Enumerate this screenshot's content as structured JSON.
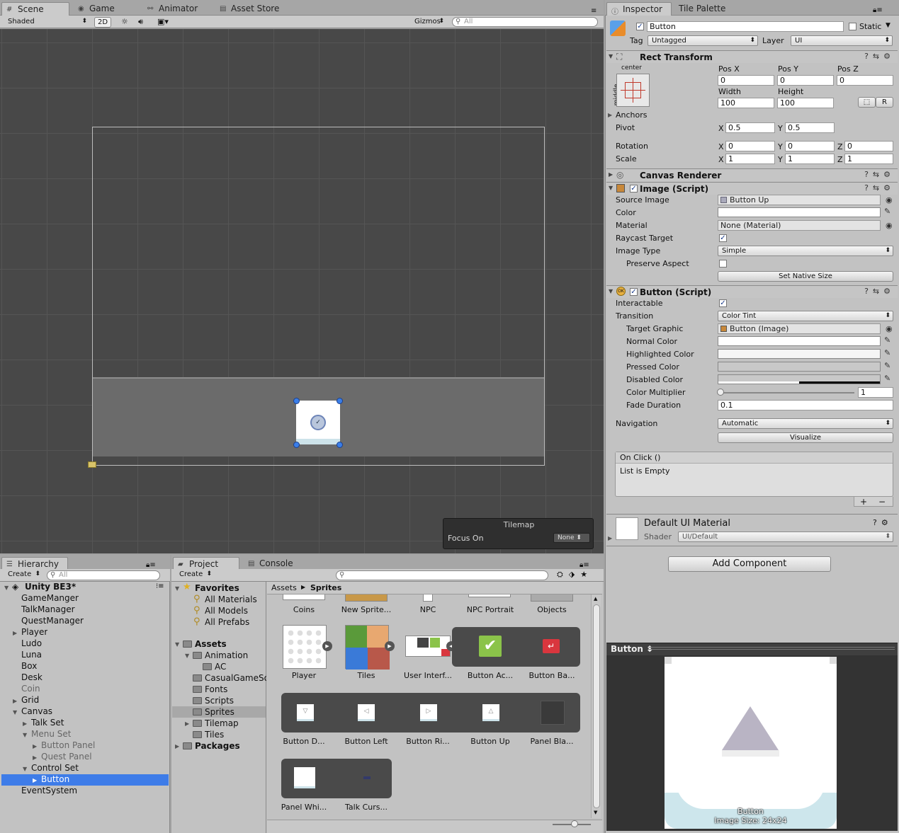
{
  "scene": {
    "tabs": [
      "Scene",
      "Game",
      "Animator",
      "Asset Store"
    ],
    "shading": "Shaded",
    "mode_2d": "2D",
    "gizmos": "Gizmos",
    "search_placeholder": "All",
    "tilemap_overlay": {
      "title": "Tilemap",
      "focus_label": "Focus On",
      "focus_value": "None"
    }
  },
  "inspector": {
    "tabs": [
      "Inspector",
      "Tile Palette"
    ],
    "object_name": "Button",
    "static_label": "Static",
    "tag_label": "Tag",
    "tag_value": "Untagged",
    "layer_label": "Layer",
    "layer_value": "UI",
    "rect_transform": {
      "title": "Rect Transform",
      "anchor_h": "center",
      "anchor_v": "middle",
      "pos_x_label": "Pos X",
      "pos_y_label": "Pos Y",
      "pos_z_label": "Pos Z",
      "pos_x": "0",
      "pos_y": "0",
      "pos_z": "0",
      "width_label": "Width",
      "height_label": "Height",
      "width": "100",
      "height": "100",
      "r_btn": "R",
      "anchors_label": "Anchors",
      "pivot_label": "Pivot",
      "pivot_x": "0.5",
      "pivot_y": "0.5",
      "rotation_label": "Rotation",
      "rot_x": "0",
      "rot_y": "0",
      "rot_z": "0",
      "scale_label": "Scale",
      "scale_x": "1",
      "scale_y": "1",
      "scale_z": "1",
      "x": "X",
      "y": "Y",
      "z": "Z"
    },
    "canvas_renderer": {
      "title": "Canvas Renderer"
    },
    "image": {
      "title": "Image (Script)",
      "source_image_label": "Source Image",
      "source_image": "Button Up",
      "color_label": "Color",
      "material_label": "Material",
      "material": "None (Material)",
      "raycast_label": "Raycast Target",
      "image_type_label": "Image Type",
      "image_type": "Simple",
      "preserve_label": "Preserve Aspect",
      "native_size_btn": "Set Native Size"
    },
    "button": {
      "title": "Button (Script)",
      "interactable_label": "Interactable",
      "transition_label": "Transition",
      "transition": "Color Tint",
      "target_graphic_label": "Target Graphic",
      "target_graphic": "Button (Image)",
      "normal_label": "Normal Color",
      "highlighted_label": "Highlighted Color",
      "pressed_label": "Pressed Color",
      "disabled_label": "Disabled Color",
      "multiplier_label": "Color Multiplier",
      "multiplier": "1",
      "fade_label": "Fade Duration",
      "fade": "0.1",
      "navigation_label": "Navigation",
      "navigation": "Automatic",
      "visualize_btn": "Visualize",
      "onclick_label": "On Click ()",
      "list_empty": "List is Empty",
      "plus": "+",
      "minus": "−"
    },
    "material": {
      "name": "Default UI Material",
      "shader_label": "Shader",
      "shader": "UI/Default"
    },
    "add_component": "Add Component",
    "preview": {
      "title": "Button",
      "caption_name": "Button",
      "caption_size": "Image Size: 24x24"
    }
  },
  "hierarchy": {
    "tab": "Hierarchy",
    "create": "Create",
    "search_placeholder": "All",
    "scene_name": "Unity BE3*",
    "items": [
      {
        "label": "GameManger",
        "indent": 0,
        "arrow": ""
      },
      {
        "label": "TalkManager",
        "indent": 0,
        "arrow": ""
      },
      {
        "label": "QuestManager",
        "indent": 0,
        "arrow": ""
      },
      {
        "label": "Player",
        "indent": 0,
        "arrow": "right"
      },
      {
        "label": "Ludo",
        "indent": 0,
        "arrow": ""
      },
      {
        "label": "Luna",
        "indent": 0,
        "arrow": ""
      },
      {
        "label": "Box",
        "indent": 0,
        "arrow": ""
      },
      {
        "label": "Desk",
        "indent": 0,
        "arrow": ""
      },
      {
        "label": "Coin",
        "indent": 0,
        "arrow": "",
        "dim": true
      },
      {
        "label": "Grid",
        "indent": 0,
        "arrow": "right"
      },
      {
        "label": "Canvas",
        "indent": 0,
        "arrow": "down"
      },
      {
        "label": "Talk Set",
        "indent": 1,
        "arrow": "right"
      },
      {
        "label": "Menu Set",
        "indent": 1,
        "arrow": "down",
        "dim": true
      },
      {
        "label": "Button Panel",
        "indent": 2,
        "arrow": "right",
        "dim": true
      },
      {
        "label": "Quest Panel",
        "indent": 2,
        "arrow": "right",
        "dim": true
      },
      {
        "label": "Control Set",
        "indent": 1,
        "arrow": "down"
      },
      {
        "label": "Button",
        "indent": 2,
        "arrow": "right",
        "selected": true
      },
      {
        "label": "EventSystem",
        "indent": 0,
        "arrow": ""
      }
    ]
  },
  "project": {
    "tabs": [
      "Project",
      "Console"
    ],
    "create": "Create",
    "breadcrumb": [
      "Assets",
      "Sprites"
    ],
    "tree": [
      {
        "label": "Favorites",
        "bold": true,
        "indent": 0
      },
      {
        "label": "All Materials",
        "indent": 1
      },
      {
        "label": "All Models",
        "indent": 1
      },
      {
        "label": "All Prefabs",
        "indent": 1
      },
      {
        "label": "Assets",
        "bold": true,
        "indent": 0
      },
      {
        "label": "Animation",
        "indent": 1
      },
      {
        "label": "AC",
        "indent": 2
      },
      {
        "label": "CasualGameSo",
        "indent": 1
      },
      {
        "label": "Fonts",
        "indent": 1
      },
      {
        "label": "Scripts",
        "indent": 1
      },
      {
        "label": "Sprites",
        "indent": 1,
        "selected": true
      },
      {
        "label": "Tilemap",
        "indent": 1
      },
      {
        "label": "Tiles",
        "indent": 1
      },
      {
        "label": "Packages",
        "bold": true,
        "indent": 0
      }
    ],
    "assets_row0": [
      "Coins",
      "New Sprite...",
      "NPC",
      "NPC Portrait",
      "Objects"
    ],
    "assets_row1": [
      "Player",
      "Tiles",
      "User Interf...",
      "Button Ac...",
      "Button Ba..."
    ],
    "assets_row2": [
      "Button D...",
      "Button Left",
      "Button Ri...",
      "Button Up",
      "Panel Bla..."
    ],
    "assets_row3": [
      "Panel Whi...",
      "Talk Curs..."
    ]
  },
  "colors": {
    "selection": "#3e7ce8",
    "accent_green": "#8bc34a",
    "accent_red": "#d9363e"
  }
}
